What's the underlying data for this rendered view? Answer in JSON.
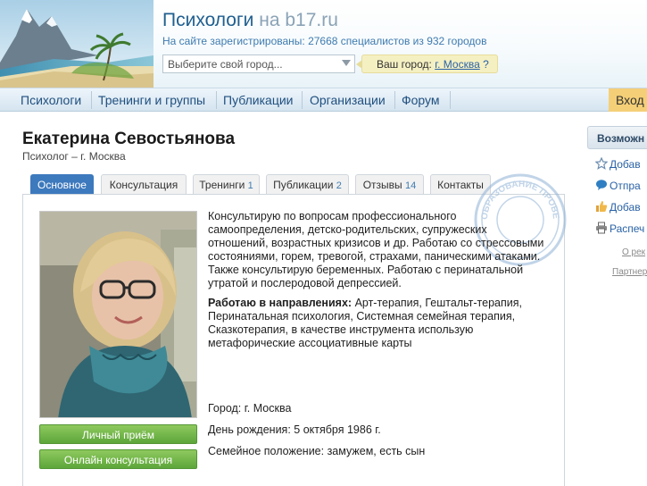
{
  "header": {
    "site_name": "Психологи",
    "site_domain": "на b17.ru",
    "subtitle": "На сайте зарегистрированы: 27668 специалистов из 932 городов",
    "city_select_placeholder": "Выберите свой город...",
    "your_city_label": "Ваш город:",
    "your_city_value": "г. Москва",
    "your_city_q": "?"
  },
  "nav": {
    "items": [
      {
        "label": "Психологи"
      },
      {
        "label": "Тренинги и группы"
      },
      {
        "label": "Публикации"
      },
      {
        "label": "Организации"
      },
      {
        "label": "Форум"
      }
    ],
    "login_label": "Вход"
  },
  "profile": {
    "name": "Екатерина Севостьянова",
    "role": "Психолог – г. Москва",
    "tabs": [
      {
        "label": "Основное",
        "count": ""
      },
      {
        "label": "Консультация",
        "count": ""
      },
      {
        "label": "Тренинги",
        "count": "1"
      },
      {
        "label": "Публикации",
        "count": "2"
      },
      {
        "label": "Отзывы",
        "count": "14"
      },
      {
        "label": "Контакты",
        "count": ""
      }
    ],
    "desc1": "Консультирую по вопросам профессионального самоопределения, детско-родительских, супружеских отношений, возрастных кризисов и др. Работаю со стрессовыми состояниями, горем, тревогой, страхами, паническими атаками. Также консультирую беременных. Работаю с перинатальной утратой и послеродовой депрессией.",
    "directions_label": "Работаю в направлениях:",
    "directions_text": "Арт-терапия, Гештальт-терапия, Перинатальная психология, Системная семейная терапия, Сказкотерапия, в качестве инструмента использую метафорические ассоциативные карты",
    "city": "Город: г. Москва",
    "birthday": "День рождения: 5 октября 1986 г.",
    "family": "Семейное положение: замужем, есть сын",
    "btn_personal": "Личный приём",
    "btn_online": "Онлайн консультация",
    "stamp_text": "ОБРАЗОВАНИЕ ПРОВЕРЕНО"
  },
  "sidebar": {
    "title": "Возможн",
    "items": [
      {
        "label": "Добав",
        "icon": "star-icon"
      },
      {
        "label": "Отпра",
        "icon": "message-icon"
      },
      {
        "label": "Добав",
        "icon": "thumbs-up-icon"
      },
      {
        "label": "Распеч",
        "icon": "printer-icon"
      }
    ],
    "link1": "О рек",
    "link2": "Партнер"
  },
  "colors": {
    "brand_blue": "#1f5f8f",
    "active_tab": "#3d79bd",
    "button_green": "#6ab044",
    "login_bg": "#f5cf77"
  }
}
